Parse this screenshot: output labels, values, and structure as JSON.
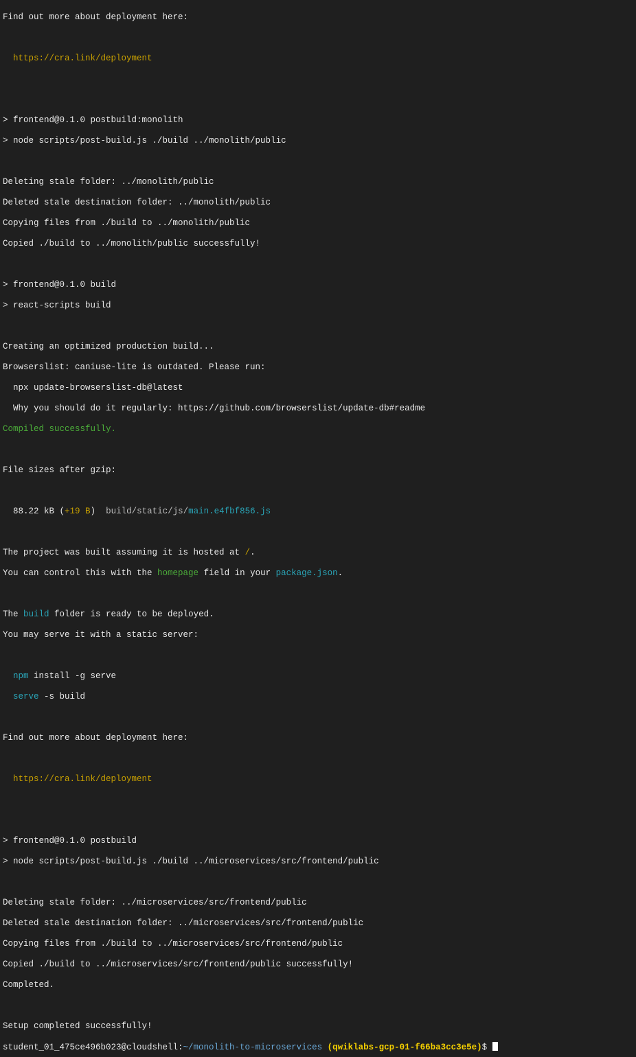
{
  "terminal": {
    "lines": {
      "l0": "Find out more about deployment here:",
      "l2": "https://cra.link/deployment",
      "l5": "> frontend@0.1.0 postbuild:monolith",
      "l6": "> node scripts/post-build.js ./build ../monolith/public",
      "l8": "Deleting stale folder: ../monolith/public",
      "l9": "Deleted stale destination folder: ../monolith/public",
      "l10": "Copying files from ./build to ../monolith/public",
      "l11": "Copied ./build to ../monolith/public successfully!",
      "l13": "> frontend@0.1.0 build",
      "l14": "> react-scripts build",
      "l16": "Creating an optimized production build...",
      "l17": "Browserslist: caniuse-lite is outdated. Please run:",
      "l18": "  npx update-browserslist-db@latest",
      "l19": "  Why you should do it regularly: https://github.com/browserslist/update-db#readme",
      "l20": "Compiled successfully.",
      "l22": "File sizes after gzip:",
      "l24_size": "88.22 kB (",
      "l24_delta": "+19 B",
      "l24_close": ")  ",
      "l24_dir": "build/static/js/",
      "l24_file": "main.e4fbf856.js",
      "l26_a": "The project was built assuming it is hosted at ",
      "l26_b": "/",
      "l26_c": ".",
      "l27_a": "You can control this with the ",
      "l27_b": "homepage",
      "l27_c": " field in your ",
      "l27_d": "package.json",
      "l27_e": ".",
      "l29_a": "The ",
      "l29_b": "build",
      "l29_c": " folder is ready to be deployed.",
      "l30": "You may serve it with a static server:",
      "l32_a": "npm",
      "l32_b": " install -g serve",
      "l33_a": "serve",
      "l33_b": " -s build",
      "l35": "Find out more about deployment here:",
      "l37": "https://cra.link/deployment",
      "l40": "> frontend@0.1.0 postbuild",
      "l41": "> node scripts/post-build.js ./build ../microservices/src/frontend/public",
      "l43": "Deleting stale folder: ../microservices/src/frontend/public",
      "l44": "Deleted stale destination folder: ../microservices/src/frontend/public",
      "l45": "Copying files from ./build to ../microservices/src/frontend/public",
      "l46": "Copied ./build to ../microservices/src/frontend/public successfully!",
      "l47": "Completed.",
      "l49": "Setup completed successfully!"
    },
    "prompt": {
      "user_host": "student_01_475ce496b023@cloudshell:",
      "path": "~/monolith-to-microservices",
      "project": "(qwiklabs-gcp-01-f66ba3cc3e5e)",
      "symbol": "$ "
    }
  },
  "colors": {
    "background": "#1f1f1f",
    "text": "#e8e8e8",
    "link": "#c8a000",
    "success": "#4cae3a",
    "highlight": "#2aa5b8",
    "project": "#f5d000",
    "path": "#6aa9d8"
  }
}
